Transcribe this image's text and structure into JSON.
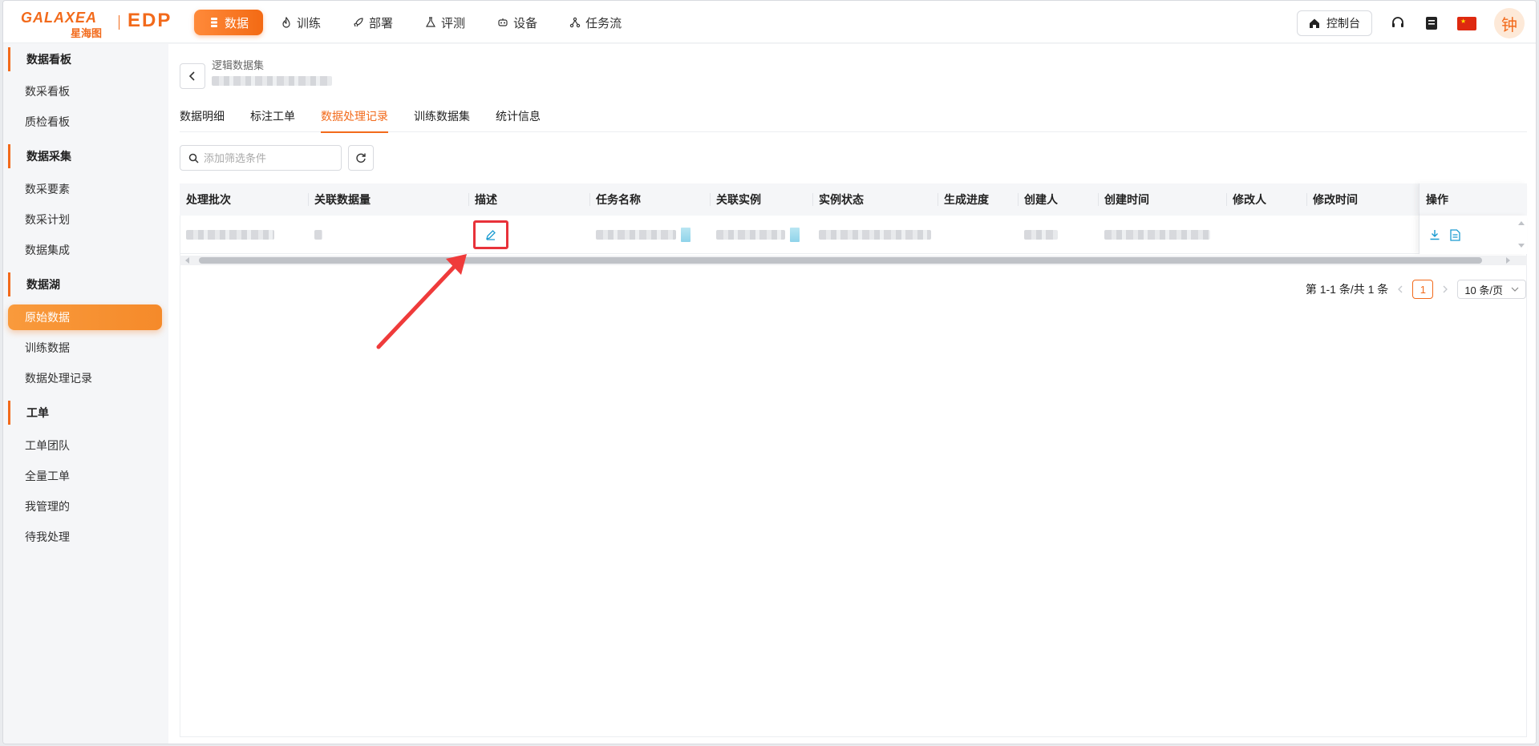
{
  "brand": {
    "logo_text": "GALAXEA",
    "logo_cn": "星海图",
    "product": "EDP"
  },
  "nav": [
    {
      "label": "数据",
      "icon": "database-icon",
      "active": true
    },
    {
      "label": "训练",
      "icon": "flame-icon"
    },
    {
      "label": "部署",
      "icon": "rocket-icon"
    },
    {
      "label": "评测",
      "icon": "flask-icon"
    },
    {
      "label": "设备",
      "icon": "robot-icon"
    },
    {
      "label": "任务流",
      "icon": "flow-icon"
    }
  ],
  "header_right": {
    "console": "控制台",
    "avatar": "钟"
  },
  "sidebar": {
    "groups": [
      {
        "title": "数据看板",
        "items": [
          "数采看板",
          "质检看板"
        ]
      },
      {
        "title": "数据采集",
        "items": [
          "数采要素",
          "数采计划",
          "数据集成"
        ]
      },
      {
        "title": "数据湖",
        "items": [
          "原始数据",
          "训练数据",
          "数据处理记录"
        ]
      },
      {
        "title": "工单",
        "items": [
          "工单团队",
          "全量工单",
          "我管理的",
          "待我处理"
        ]
      }
    ],
    "active_item": "原始数据"
  },
  "page": {
    "breadcrumb": "逻辑数据集",
    "tabs": [
      "数据明细",
      "标注工单",
      "数据处理记录",
      "训练数据集",
      "统计信息"
    ],
    "active_tab": "数据处理记录",
    "filter_placeholder": "添加筛选条件"
  },
  "table": {
    "columns": [
      "处理批次",
      "关联数据量",
      "描述",
      "任务名称",
      "关联实例",
      "实例状态",
      "生成进度",
      "创建人",
      "创建时间",
      "修改人",
      "修改时间",
      "操作"
    ]
  },
  "pagination": {
    "summary": "第 1-1 条/共 1 条",
    "current": "1",
    "page_size": "10 条/页"
  }
}
